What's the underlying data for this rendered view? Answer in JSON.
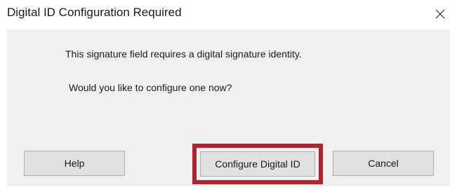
{
  "window": {
    "title": "Digital ID Configuration Required",
    "close_icon": "close-icon"
  },
  "message": {
    "line1": "This signature field requires a digital signature identity.",
    "line2": "Would you like to configure one now?"
  },
  "buttons": {
    "help": "Help",
    "configure": "Configure Digital ID",
    "cancel": "Cancel"
  },
  "colors": {
    "highlight": "#b0232a",
    "body_background": "#f0f0f0",
    "button_background": "#e1e1e1"
  }
}
